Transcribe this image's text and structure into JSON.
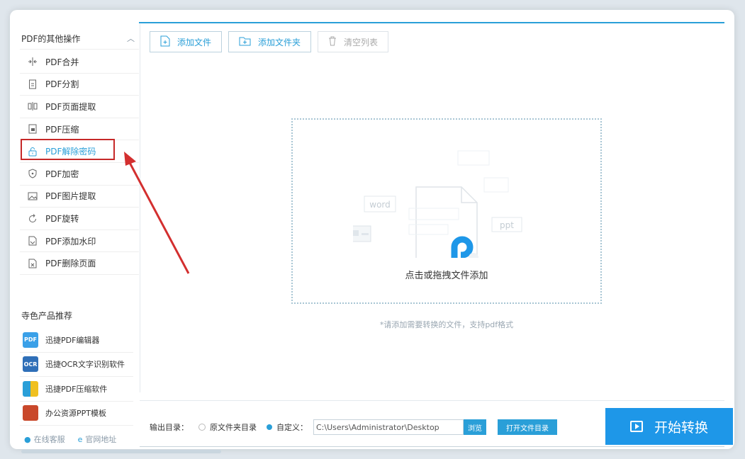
{
  "sidebar": {
    "header": "PDF的其他操作",
    "items": [
      {
        "label": "PDF合并",
        "icon": "merge-icon"
      },
      {
        "label": "PDF分割",
        "icon": "split-icon"
      },
      {
        "label": "PDF页面提取",
        "icon": "page-extract-icon"
      },
      {
        "label": "PDF压缩",
        "icon": "compress-icon"
      },
      {
        "label": "PDF解除密码",
        "icon": "unlock-icon"
      },
      {
        "label": "PDF加密",
        "icon": "shield-icon"
      },
      {
        "label": "PDF图片提取",
        "icon": "image-icon"
      },
      {
        "label": "PDF旋转",
        "icon": "rotate-icon"
      },
      {
        "label": "PDF添加水印",
        "icon": "watermark-icon"
      },
      {
        "label": "PDF删除页面",
        "icon": "delete-page-icon"
      }
    ],
    "products_title": "寺色产品推荐",
    "products": [
      {
        "label": "迅捷PDF编辑器",
        "icon": "pdf-editor-icon",
        "badge": "PDF",
        "color": "#3aa0e8"
      },
      {
        "label": "迅捷OCR文字识别软件",
        "icon": "ocr-icon",
        "badge": "OCR",
        "color": "#2f6fb8"
      },
      {
        "label": "迅捷PDF压缩软件",
        "icon": "pdf-compress-icon",
        "badge": "",
        "color": "#2a9fd8"
      },
      {
        "label": "办公资源PPT模板",
        "icon": "ppt-template-icon",
        "badge": "",
        "color": "#c9482b"
      }
    ],
    "footer": {
      "service": "在线客服",
      "website": "官网地址"
    }
  },
  "toolbar": {
    "add_file": "添加文件",
    "add_folder": "添加文件夹",
    "clear_list": "清空列表"
  },
  "dropzone": {
    "text": "点击或拖拽文件添加",
    "hint": "*请添加需要转换的文件，支持pdf格式",
    "tag_word": "word",
    "tag_ppt": "ppt"
  },
  "output": {
    "label": "输出目录：",
    "option_source": "原文件夹目录",
    "option_custom": "自定义：",
    "path": "C:\\Users\\Administrator\\Desktop",
    "browse": "浏览",
    "open_folder": "打开文件目录"
  },
  "start_button": "开始转换",
  "colors": {
    "accent": "#2a9fd8",
    "highlight": "#c62828"
  }
}
